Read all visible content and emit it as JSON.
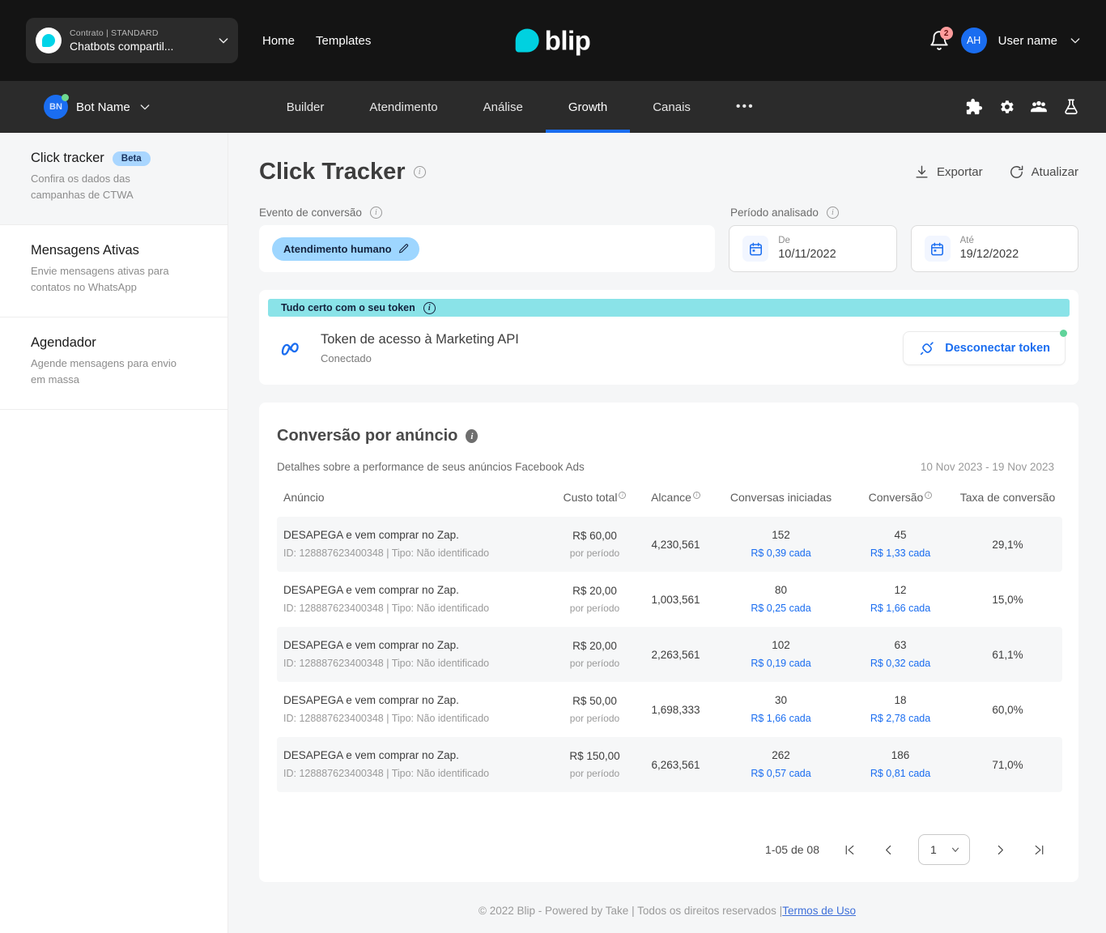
{
  "topbar": {
    "contract": {
      "sub_label": "Contrato | STANDARD",
      "name": "Chatbots compartil..."
    },
    "links": [
      "Home",
      "Templates"
    ],
    "logo_text": "blip",
    "notifications_count": "2",
    "user_initials": "AH",
    "user_name": "User name"
  },
  "botbar": {
    "bot_initials": "BN",
    "bot_name": "Bot Name",
    "tabs": [
      {
        "label": "Builder",
        "active": false
      },
      {
        "label": "Atendimento",
        "active": false
      },
      {
        "label": "Análise",
        "active": false
      },
      {
        "label": "Growth",
        "active": true
      },
      {
        "label": "Canais",
        "active": false
      },
      {
        "label": "•••",
        "active": false
      }
    ],
    "icons": [
      "puzzle-icon",
      "gear-icon",
      "people-icon",
      "flask-icon"
    ],
    "accent_color": "#1a6df0"
  },
  "sidebar": {
    "items": [
      {
        "title": "Click tracker",
        "badge": "Beta",
        "desc": "Confira os dados das campanhas de CTWA",
        "active": true
      },
      {
        "title": "Mensagens Ativas",
        "badge": "",
        "desc": "Envie mensagens ativas para contatos no WhatsApp",
        "active": false
      },
      {
        "title": "Agendador",
        "badge": "",
        "desc": "Agende mensagens para envio em massa",
        "active": false
      }
    ]
  },
  "page": {
    "title": "Click Tracker",
    "export_label": "Exportar",
    "refresh_label": "Atualizar"
  },
  "filters": {
    "event_label": "Evento de conversão",
    "event_chip": "Atendimento humano",
    "period_label": "Período analisado",
    "date_from_label": "De",
    "date_from_value": "10/11/2022",
    "date_to_label": "Até",
    "date_to_value": "19/12/2022"
  },
  "token": {
    "banner": "Tudo certo com o seu token",
    "name": "Token de acesso à Marketing API",
    "status": "Conectado",
    "disconnect_label": "Desconectar token",
    "banner_color": "#8ae3e8",
    "status_dot_color": "#5fd39a"
  },
  "conversion": {
    "title": "Conversão por anúncio",
    "subtitle": "Detalhes sobre a performance de seus anúncios Facebook Ads",
    "date_range": "10 Nov 2023 - 19 Nov 2023",
    "columns": [
      "Anúncio",
      "Custo total",
      "Alcance",
      "Conversas iniciadas",
      "Conversão",
      "Taxa de conversão"
    ],
    "cost_sub_label": "por período",
    "rows": [
      {
        "name": "DESAPEGA e vem comprar no Zap.",
        "id": "ID: 128887623400348 | Tipo: Não identificado",
        "cost": "R$ 60,00",
        "reach": "4,230,561",
        "conversations": "152",
        "conversations_each": "R$ 0,39 cada",
        "conversions": "45",
        "conversions_each": "R$ 1,33 cada",
        "rate": "29,1%"
      },
      {
        "name": "DESAPEGA e vem comprar no Zap.",
        "id": "ID: 128887623400348 | Tipo: Não identificado",
        "cost": "R$ 20,00",
        "reach": "1,003,561",
        "conversations": "80",
        "conversations_each": "R$ 0,25 cada",
        "conversions": "12",
        "conversions_each": "R$ 1,66 cada",
        "rate": "15,0%"
      },
      {
        "name": "DESAPEGA e vem comprar no Zap.",
        "id": "ID: 128887623400348 | Tipo: Não identificado",
        "cost": "R$ 20,00",
        "reach": "2,263,561",
        "conversations": "102",
        "conversations_each": "R$ 0,19 cada",
        "conversions": "63",
        "conversions_each": "R$ 0,32 cada",
        "rate": "61,1%"
      },
      {
        "name": "DESAPEGA e vem comprar no Zap.",
        "id": "ID: 128887623400348 | Tipo: Não identificado",
        "cost": "R$ 50,00",
        "reach": "1,698,333",
        "conversations": "30",
        "conversations_each": "R$ 1,66 cada",
        "conversions": "18",
        "conversions_each": "R$ 2,78 cada",
        "rate": "60,0%"
      },
      {
        "name": "DESAPEGA e vem comprar no Zap.",
        "id": "ID: 128887623400348 | Tipo: Não identificado",
        "cost": "R$ 150,00",
        "reach": "6,263,561",
        "conversations": "262",
        "conversations_each": "R$ 0,57 cada",
        "conversions": "186",
        "conversions_each": "R$ 0,81 cada",
        "rate": "71,0%"
      }
    ]
  },
  "pagination": {
    "count_label": "1-05 de 08",
    "current_page": "1"
  },
  "footer": {
    "text": "© 2022 Blip - Powered by Take | Todos os direitos reservados |",
    "link": "Termos de Uso"
  }
}
